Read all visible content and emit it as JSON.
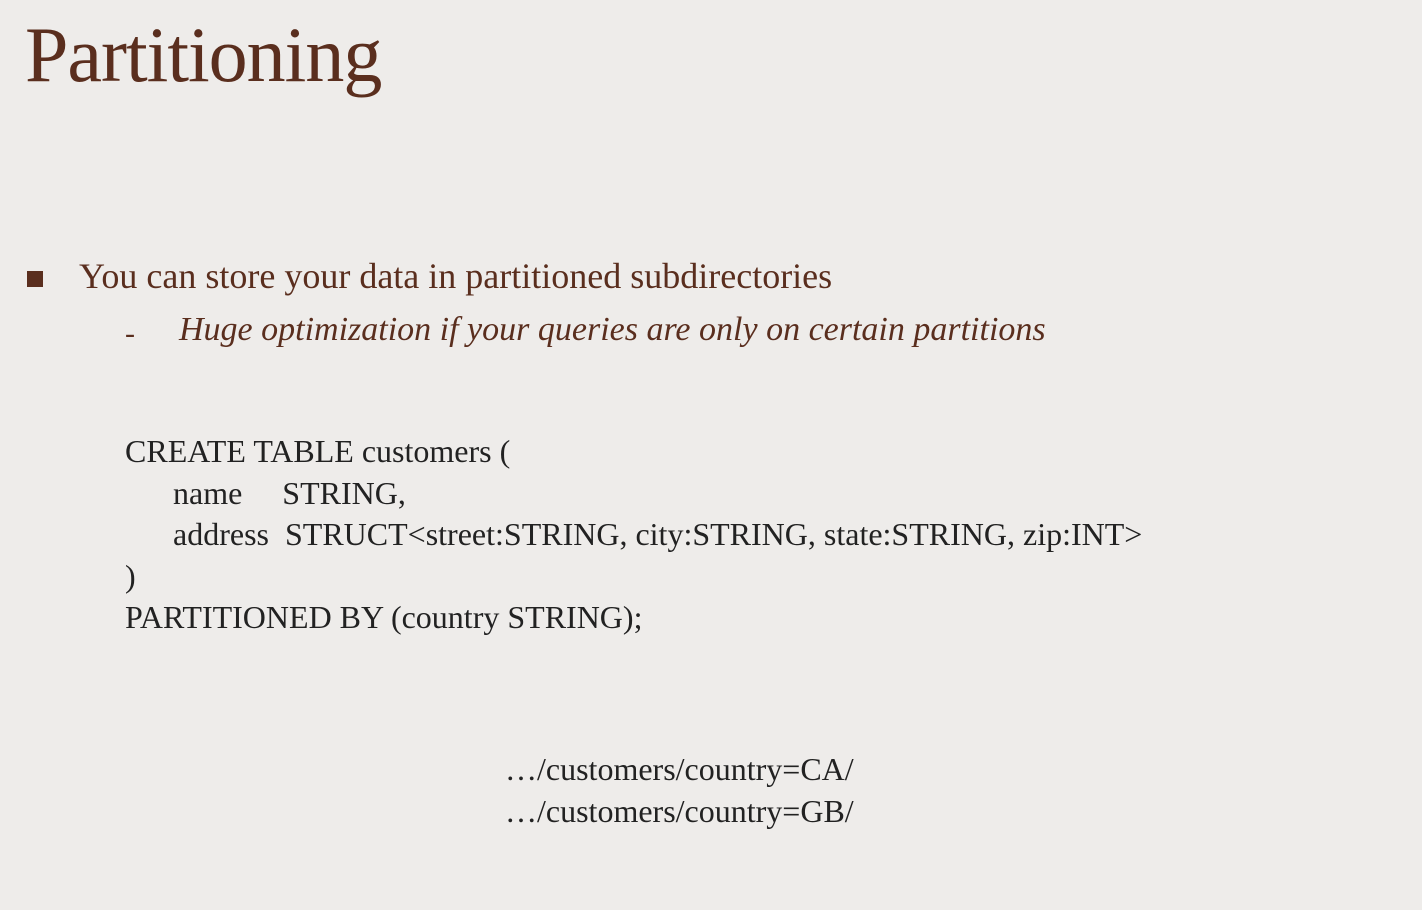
{
  "title": "Partitioning",
  "bullet": "You can store your data in partitioned subdirectories",
  "subBullet": "Huge optimization if your queries are only on certain partitions",
  "code": "CREATE TABLE customers (\n      name     STRING,\n      address  STRUCT<street:STRING, city:STRING, state:STRING, zip:INT>\n)\nPARTITIONED BY (country STRING);",
  "path1": "…/customers/country=CA/",
  "path2": "…/customers/country=GB/"
}
